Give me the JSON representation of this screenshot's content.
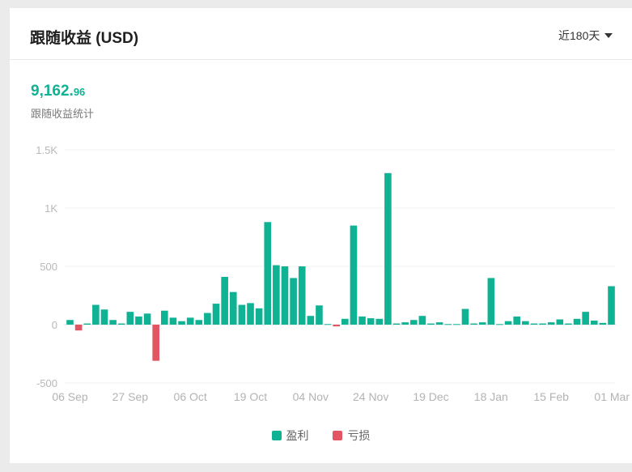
{
  "header": {
    "title": "跟随收益 (USD)",
    "range_label": "近180天"
  },
  "summary": {
    "total_int": "9,162.",
    "total_dec": "96",
    "label": "跟随收益统计"
  },
  "colors": {
    "profit": "#10b294",
    "loss": "#e35562"
  },
  "chart_data": {
    "type": "bar",
    "y_ticks": [
      "1.5K",
      "1K",
      "500",
      "0",
      "-500"
    ],
    "y_tick_values": [
      1500,
      1000,
      500,
      0,
      -500
    ],
    "ylim": [
      -500,
      1500
    ],
    "x_tick_labels": [
      "06 Sep",
      "27 Sep",
      "06 Oct",
      "19 Oct",
      "04 Nov",
      "24 Nov",
      "19 Dec",
      "18 Jan",
      "15 Feb",
      "01 Mar"
    ],
    "x_tick_bar_index": [
      0,
      7,
      14,
      21,
      28,
      35,
      42,
      49,
      56,
      63
    ],
    "legend": [
      {
        "name": "盈利",
        "color": "#10b294"
      },
      {
        "name": "亏损",
        "color": "#e35562"
      }
    ],
    "values": [
      40,
      -50,
      10,
      170,
      130,
      40,
      10,
      110,
      70,
      95,
      -310,
      120,
      60,
      30,
      60,
      40,
      100,
      180,
      410,
      280,
      170,
      185,
      140,
      880,
      510,
      500,
      400,
      500,
      75,
      165,
      5,
      -15,
      50,
      850,
      70,
      55,
      50,
      1300,
      10,
      20,
      40,
      75,
      10,
      20,
      5,
      5,
      135,
      10,
      20,
      400,
      5,
      30,
      70,
      30,
      10,
      10,
      20,
      45,
      10,
      50,
      110,
      35,
      15,
      330
    ]
  }
}
